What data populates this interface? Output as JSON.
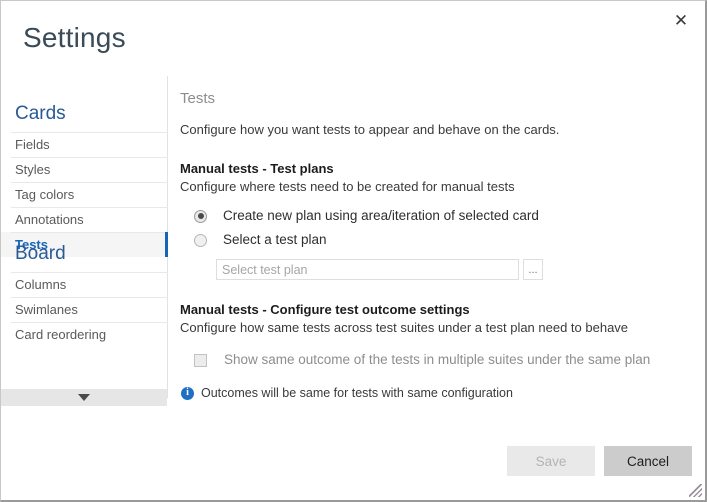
{
  "window": {
    "title": "Settings",
    "close_label": "✕"
  },
  "sidebar": {
    "groups": [
      {
        "title": "Cards",
        "items": [
          {
            "label": "Fields",
            "selected": false
          },
          {
            "label": "Styles",
            "selected": false
          },
          {
            "label": "Tag colors",
            "selected": false
          },
          {
            "label": "Annotations",
            "selected": false
          },
          {
            "label": "Tests",
            "selected": true
          }
        ]
      },
      {
        "title": "Board",
        "items": [
          {
            "label": "Columns",
            "selected": false
          },
          {
            "label": "Swimlanes",
            "selected": false
          },
          {
            "label": "Card reordering",
            "selected": false
          }
        ]
      }
    ],
    "scroll_down_icon": "chevron-down-icon",
    "accent_color": "#1565b8"
  },
  "content": {
    "title": "Tests",
    "intro": "Configure how you want tests to appear and behave on the cards.",
    "test_plans_section": {
      "title": "Manual tests - Test plans",
      "subtitle": "Configure where tests need to be created for manual tests",
      "options": [
        {
          "label": "Create new plan using area/iteration of selected card",
          "checked": true
        },
        {
          "label": "Select a test plan",
          "checked": false
        }
      ],
      "plan_input": {
        "value": "",
        "placeholder": "Select test plan"
      },
      "browse_label": "..."
    },
    "outcome_section": {
      "title": "Manual tests - Configure test outcome settings",
      "subtitle": "Configure how same tests across test suites under a test plan need to behave",
      "checkbox": {
        "label": "Show same outcome of the tests in multiple suites under the same plan",
        "checked": false
      },
      "info": {
        "icon": "info-icon",
        "glyph": "i",
        "text": "Outcomes will be same for tests with same configuration",
        "color": "#1f6fc4"
      }
    }
  },
  "footer": {
    "save_label": "Save",
    "cancel_label": "Cancel"
  }
}
